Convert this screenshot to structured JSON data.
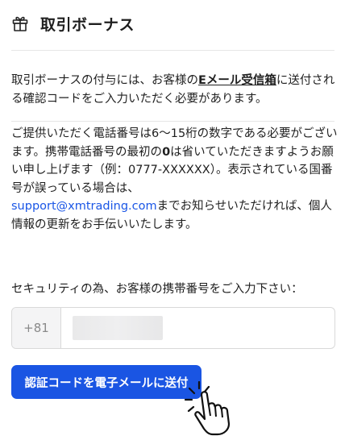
{
  "header": {
    "icon": "gift-icon",
    "title": "取引ボーナス"
  },
  "paragraph1": {
    "before": "取引ボーナスの付与には、お客様の",
    "link": "Eメール受信箱",
    "after": "に送付される確認コードをご入力いただく必要があります。"
  },
  "paragraph2": {
    "line1": "ご提供いただく電話番号は6〜15桁の数字である必要がございます。携帯電話番号の最初の",
    "bold": "0",
    "line2": "は省いていただきますようお願い申し上げます（例：0777-XXXXXX）。表示されている国番号が誤っている場合は、",
    "email": "support@xmtrading.com",
    "line3": "までお知らせいただければ、個人情報の更新をお手伝いいたします。"
  },
  "phone_section": {
    "label": "セキュリティの為、お客様の携帯番号をご入力下さい：",
    "country_code": "+81"
  },
  "send_button": {
    "label": "認証コードを電子メールに送付"
  },
  "colors": {
    "accent": "#1a55e3",
    "link": "#1a56e6"
  },
  "icons": {
    "cursor": "pointer-hand-icon"
  }
}
